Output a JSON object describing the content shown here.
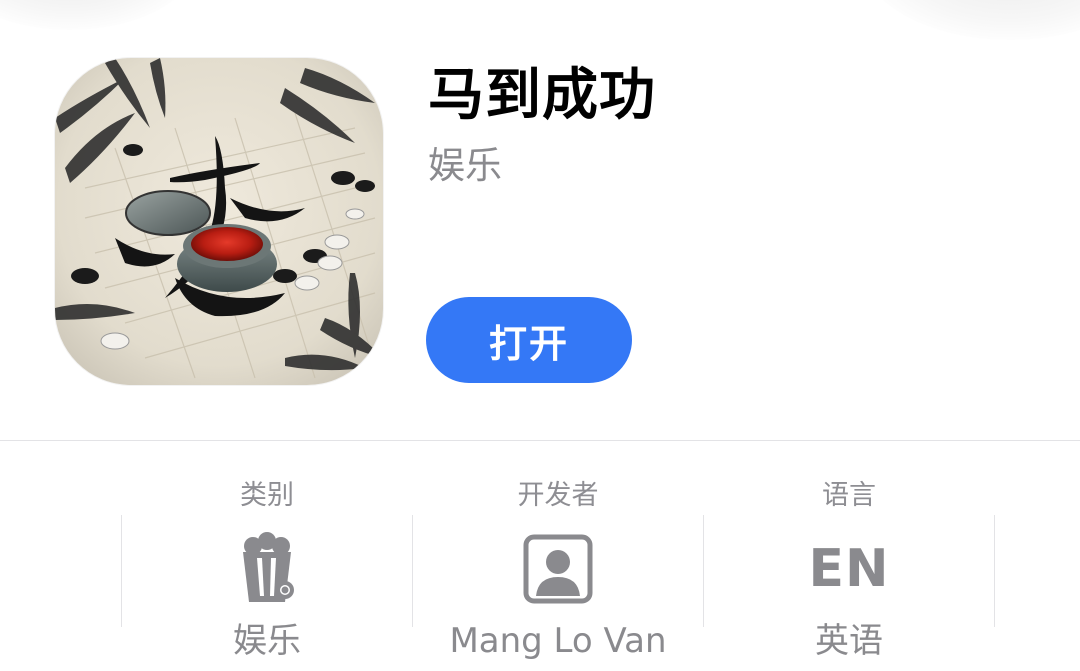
{
  "app": {
    "title": "马到成功",
    "category_subtitle": "娱乐",
    "open_button_label": "打开"
  },
  "info": [
    {
      "label": "类别",
      "icon": "popcorn-icon",
      "value": "娱乐"
    },
    {
      "label": "开发者",
      "icon": "person-portrait-icon",
      "value": "Mang Lo Van"
    },
    {
      "label": "语言",
      "icon_text": "EN",
      "value": "英语"
    }
  ],
  "colors": {
    "accent": "#3478f6",
    "secondary_text": "#8a8a8e",
    "separator": "#e3e3e6"
  }
}
